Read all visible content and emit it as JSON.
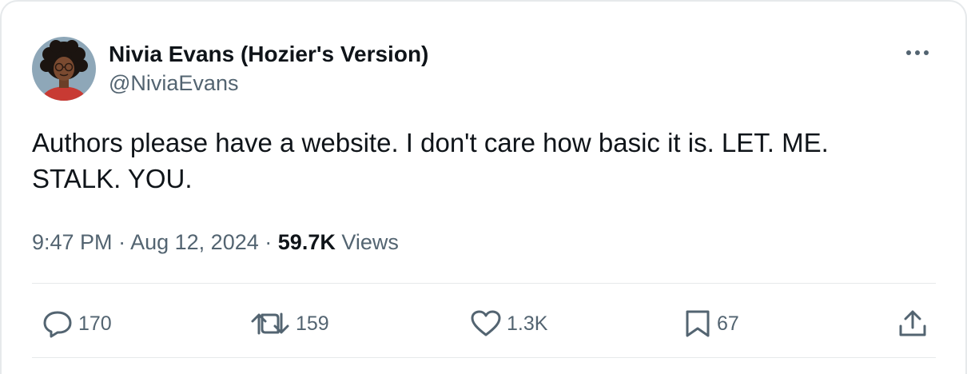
{
  "tweet": {
    "author": {
      "display_name": "Nivia Evans (Hozier's Version)",
      "handle": "@NiviaEvans",
      "avatar": "cartoon-avatar-curly-hair-glasses"
    },
    "text": "Authors please have a website. I don't care how basic it is. LET. ME.\nSTALK. YOU.",
    "time": "9:47 PM",
    "separator": "·",
    "date": "Aug 12, 2024",
    "views_count": "59.7K",
    "views_label": "Views"
  },
  "actions": {
    "reply": {
      "icon": "reply-bubble-icon",
      "count": "170"
    },
    "repost": {
      "icon": "repost-arrows-icon",
      "count": "159"
    },
    "like": {
      "icon": "heart-icon",
      "count": "1.3K"
    },
    "bookmark": {
      "icon": "bookmark-icon",
      "count": "67"
    },
    "share": {
      "icon": "share-upload-icon"
    }
  },
  "colors": {
    "text_primary": "#0f1419",
    "text_secondary": "#536471",
    "border": "#e6e9eb",
    "avatar_background": "#8ea7b8",
    "avatar_shirt": "#c83a33"
  }
}
